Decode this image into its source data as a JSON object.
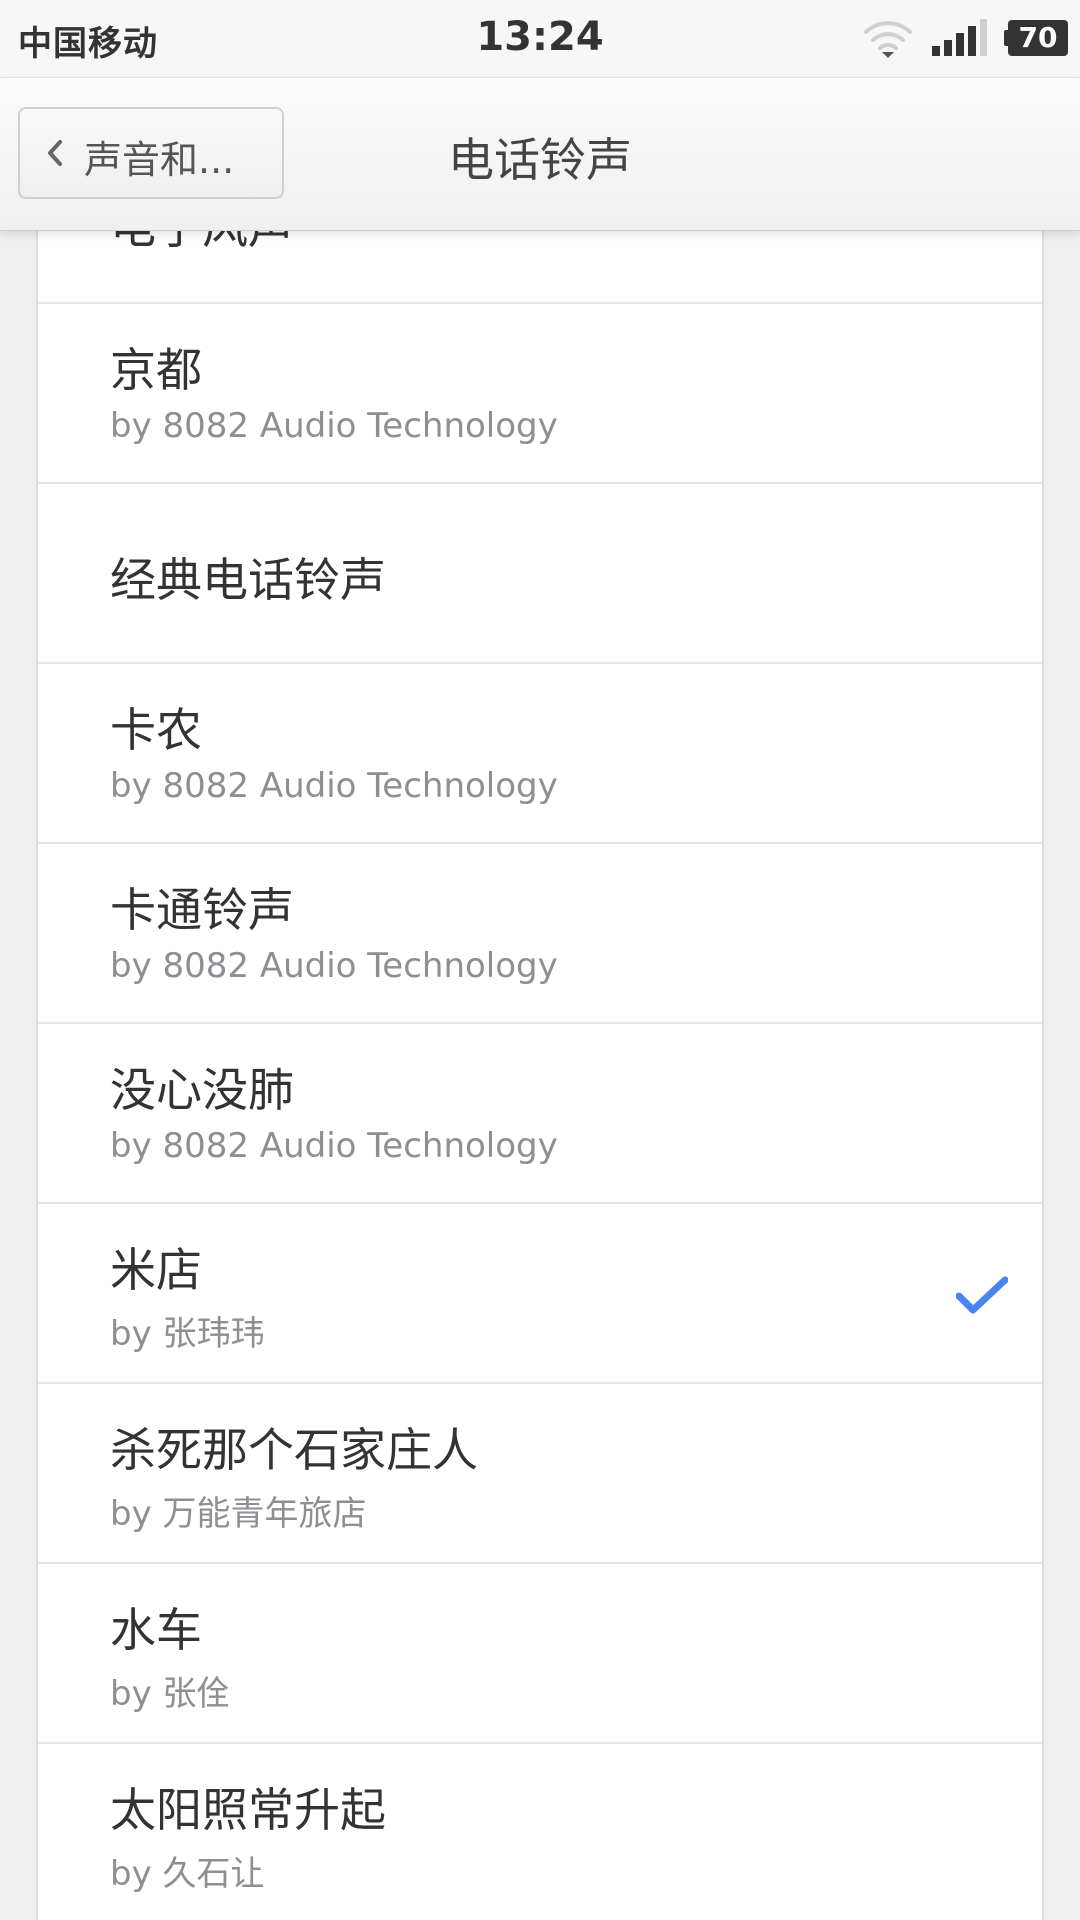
{
  "status_bar": {
    "carrier": "中国移动",
    "time": "13:24",
    "battery": "70",
    "icons": [
      "wifi-icon",
      "signal-icon",
      "battery-icon"
    ]
  },
  "nav": {
    "back_label": "声音和...",
    "title": "电话铃声",
    "back_icon": "chevron-left-icon"
  },
  "ringtones": {
    "partial_title": "电子风声",
    "items": [
      {
        "title": "京都",
        "subtitle": "by 8082 Audio Technology",
        "selected": false
      },
      {
        "title": "经典电话铃声",
        "subtitle": "",
        "selected": false
      },
      {
        "title": "卡农",
        "subtitle": "by 8082 Audio Technology",
        "selected": false
      },
      {
        "title": "卡通铃声",
        "subtitle": "by 8082 Audio Technology",
        "selected": false
      },
      {
        "title": "没心没肺",
        "subtitle": "by 8082 Audio Technology",
        "selected": false
      },
      {
        "title": "米店",
        "subtitle": "by 张玮玮",
        "selected": true
      },
      {
        "title": "杀死那个石家庄人",
        "subtitle": "by 万能青年旅店",
        "selected": false
      },
      {
        "title": "水车",
        "subtitle": "by 张佺",
        "selected": false
      },
      {
        "title": "太阳照常升起",
        "subtitle": "by 久石让",
        "selected": false
      }
    ]
  },
  "colors": {
    "accent": "#4a84f0",
    "background": "#efeff0",
    "subtitle": "#8e8e93"
  }
}
